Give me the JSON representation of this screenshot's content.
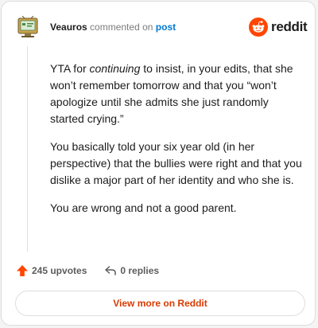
{
  "header": {
    "username": "Veauros",
    "action_text": "commented on",
    "post_link": "post",
    "brand": "reddit",
    "avatar_icon": "computer-avatar-icon"
  },
  "comment": {
    "p1_a": "YTA for ",
    "p1_italic": "continuing",
    "p1_b": " to insist, in your edits, that she won’t remember tomorrow and that you “won’t apologize until she admits she just randomly started crying.”",
    "p2": "You basically told your six year old (in her perspective) that the bullies were right and that you dislike a major part of her identity and who she is.",
    "p3": "You are wrong and not a good parent."
  },
  "footer": {
    "upvotes": "245 upvotes",
    "replies": "0 replies"
  },
  "cta": {
    "label": "View more on Reddit"
  },
  "colors": {
    "accent": "#ff4500",
    "link": "#0079d3",
    "cta_text": "#d93a00"
  }
}
